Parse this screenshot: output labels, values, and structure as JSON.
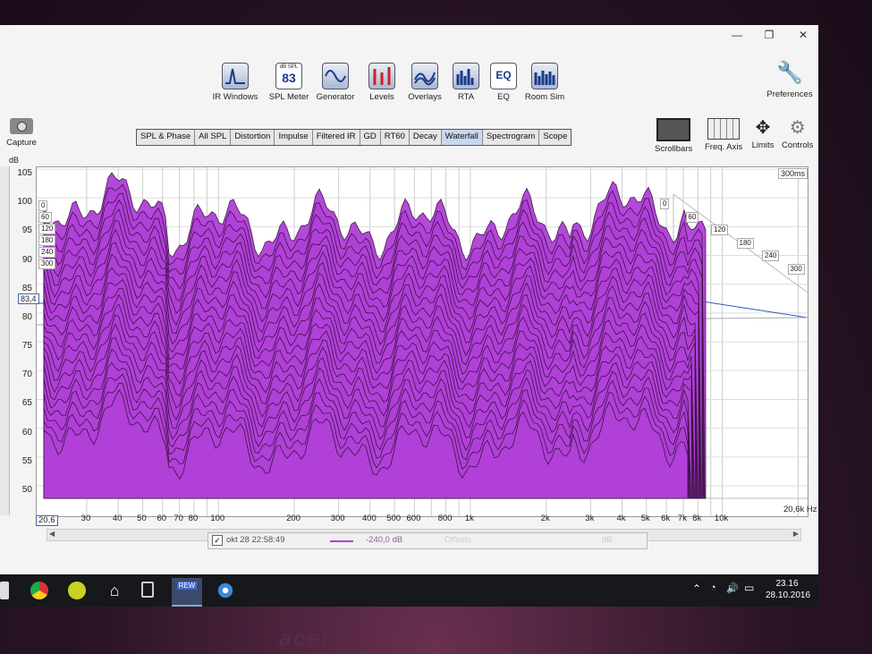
{
  "window": {
    "minimize": "—",
    "maximize": "❐",
    "close": "✕"
  },
  "toolbar": [
    {
      "label": "IR Windows",
      "icon": "ir-windows-icon"
    },
    {
      "label": "SPL Meter",
      "icon": "spl-meter-icon",
      "badge_top": "dB SPL",
      "badge_value": "83"
    },
    {
      "label": "Generator",
      "icon": "generator-icon"
    },
    {
      "label": "Levels",
      "icon": "levels-icon"
    },
    {
      "label": "Overlays",
      "icon": "overlays-icon"
    },
    {
      "label": "RTA",
      "icon": "rta-icon"
    },
    {
      "label": "EQ",
      "icon": "eq-icon",
      "badge_value": "EQ"
    },
    {
      "label": "Room Sim",
      "icon": "room-sim-icon"
    }
  ],
  "preferences_label": "Preferences",
  "capture_label": "Capture",
  "tabs": [
    "SPL & Phase",
    "All SPL",
    "Distortion",
    "Impulse",
    "Filtered IR",
    "GD",
    "RT60",
    "Decay",
    "Waterfall",
    "Spectrogram",
    "Scope"
  ],
  "active_tab": "Waterfall",
  "controls": [
    "Scrollbars",
    "Freq. Axis",
    "Limits",
    "Controls"
  ],
  "graph": {
    "y_unit": "dB",
    "y_ticks": [
      "105",
      "100",
      "95",
      "90",
      "85",
      "80",
      "75",
      "70",
      "65",
      "60",
      "55",
      "50"
    ],
    "y_cursor": "83,4",
    "x_start": "20,6",
    "x_ticks": [
      "30",
      "40",
      "50",
      "60",
      "70",
      "80",
      "100",
      "200",
      "300",
      "400",
      "500",
      "600",
      "800",
      "1k",
      "2k",
      "3k",
      "4k",
      "5k",
      "6k",
      "7k",
      "8k",
      "10k"
    ],
    "x_end": "20,6k Hz",
    "time_corner": "300ms",
    "time_left": [
      "0",
      "60",
      "120",
      "180",
      "240",
      "300"
    ],
    "time_right": [
      "0",
      "60",
      "120",
      "180",
      "240",
      "300"
    ],
    "fill_color": "#b040d8",
    "line_color": "#3a1040"
  },
  "status": {
    "date": "okt 28 22:58:49",
    "level": "-240,0 dB",
    "extra": "Offsets",
    "extra2": "dB"
  },
  "taskbar": {
    "time": "23.16",
    "date": "28.10.2016",
    "app_badge": "REW"
  },
  "brand": "acer"
}
